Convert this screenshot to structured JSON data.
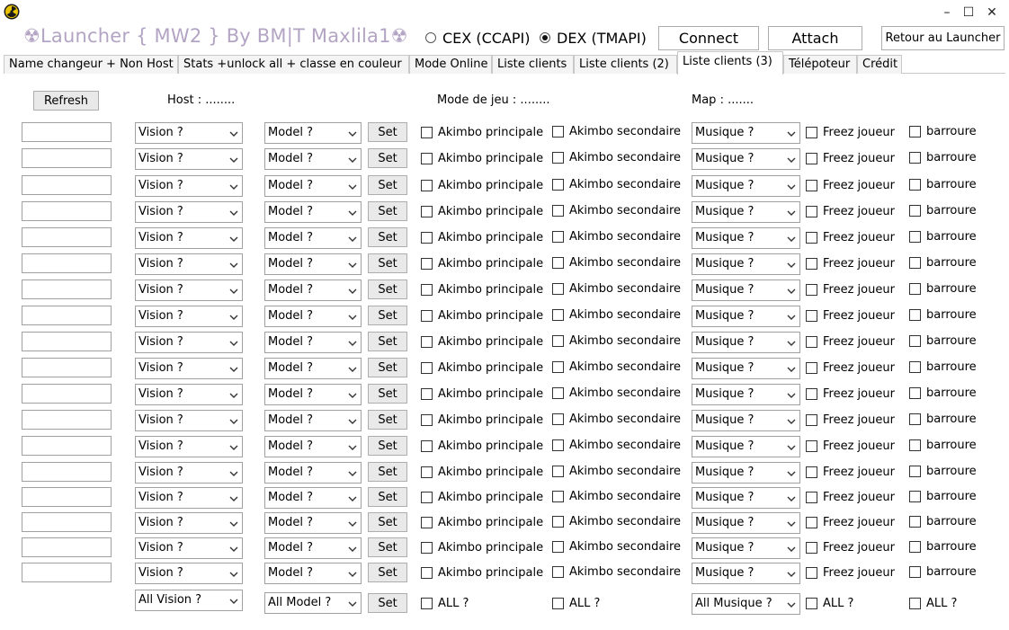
{
  "title": "☢Launcher { MW2 }  By BM|T Maxlila1☢",
  "window_controls": {
    "minimize": "–",
    "maximize": "☐",
    "close": "✕"
  },
  "api_options": [
    {
      "label": "CEX (CCAPI)",
      "selected": false
    },
    {
      "label": "DEX (TMAPI)",
      "selected": true
    }
  ],
  "buttons": {
    "connect": "Connect",
    "attach": "Attach",
    "retour": "Retour au Launcher"
  },
  "tabs": [
    {
      "label": "Name changeur + Non Host",
      "active": false
    },
    {
      "label": "Stats +unlock all + classe en couleur",
      "active": false
    },
    {
      "label": "Mode Online",
      "active": false
    },
    {
      "label": "Liste clients",
      "active": false
    },
    {
      "label": "Liste clients (2)",
      "active": false
    },
    {
      "label": "Liste clients (3)",
      "active": true
    },
    {
      "label": "Télépoteur",
      "active": false
    },
    {
      "label": "Crédit",
      "active": false
    }
  ],
  "header": {
    "refresh": "Refresh",
    "host": "Host :   ........",
    "mode": "Mode de jeu :  ........",
    "map": "Map :    ......."
  },
  "row_template": {
    "vision": "Vision ?",
    "model": "Model   ?",
    "set": "Set",
    "akimbo1": "Akimbo principale",
    "akimbo2": "Akimbo secondaire",
    "musique": "Musique   ?",
    "freez": "Freez joueur",
    "barroure": "barroure"
  },
  "row_count": 18,
  "footer": {
    "vision": "All Vision ?",
    "model": "All Model   ?",
    "set": "Set",
    "all1": "ALL ?",
    "all2": "ALL ?",
    "musique": "All Musique   ?",
    "all3": "ALL ?",
    "all4": "ALL ?"
  }
}
